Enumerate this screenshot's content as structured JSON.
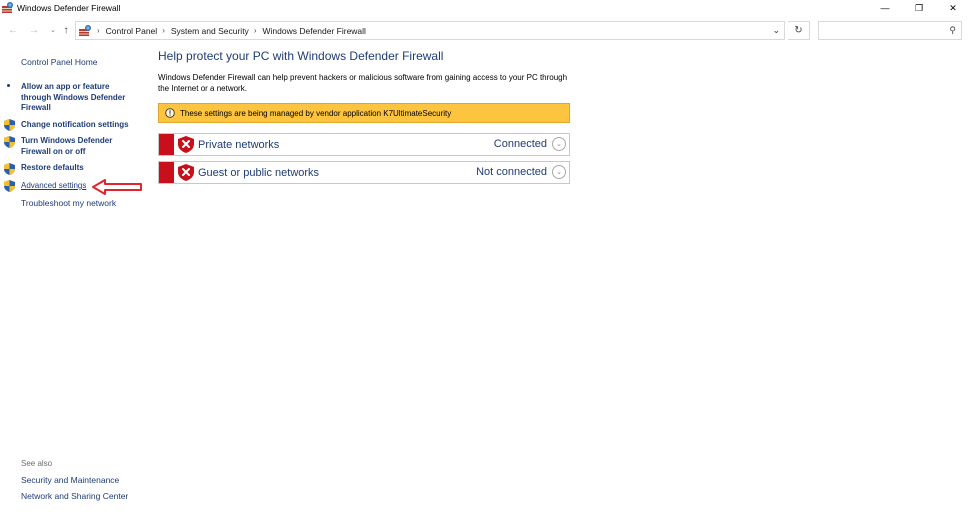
{
  "window": {
    "title": "Windows Defender Firewall",
    "minimize_glyph": "—",
    "maximize_glyph": "❐",
    "close_glyph": "✕"
  },
  "address_bar": {
    "breadcrumbs": [
      "Control Panel",
      "System and Security",
      "Windows Defender Firewall"
    ],
    "separator": "›",
    "dropdown_glyph": "⌄",
    "refresh_glyph": "↻",
    "search_glyph": "⚲",
    "back_glyph": "←",
    "forward_glyph": "→",
    "recent_glyph": "⌄",
    "up_glyph": "↑"
  },
  "left_pane": {
    "home_link": "Control Panel Home",
    "tasks": [
      {
        "label": "Allow an app or feature through Windows Defender Firewall",
        "icon": "bullet"
      },
      {
        "label": "Change notification settings",
        "icon": "uac-shield-icon"
      },
      {
        "label": "Turn Windows Defender Firewall on or off",
        "icon": "uac-shield-icon"
      },
      {
        "label": "Restore defaults",
        "icon": "uac-shield-icon"
      },
      {
        "label": "Advanced settings",
        "icon": "uac-shield-icon"
      }
    ],
    "troubleshoot_link": "Troubleshoot my network",
    "see_also": {
      "heading": "See also",
      "links": [
        "Security and Maintenance",
        "Network and Sharing Center"
      ]
    }
  },
  "main": {
    "title": "Help protect your PC with Windows Defender Firewall",
    "description": "Windows Defender Firewall can help prevent hackers or malicious software from gaining access to your PC through the Internet or a network.",
    "banner": "These settings are being managed by vendor application K7UltimateSecurity",
    "networks": [
      {
        "name": "Private networks",
        "status": "Connected"
      },
      {
        "name": "Guest or public networks",
        "status": "Not connected"
      }
    ],
    "expand_glyph": "⌄"
  },
  "colors": {
    "link": "#1e3c78",
    "banner": "#fdc43f",
    "alert_red": "#c8101d",
    "annotation_red": "#e0262b"
  }
}
